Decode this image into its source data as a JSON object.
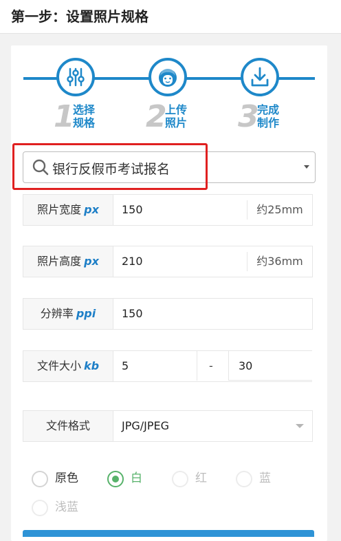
{
  "header": {
    "title": "第一步：设置照片规格"
  },
  "steps": [
    {
      "number": "1",
      "label_line1": "选择",
      "label_line2": "规格",
      "icon": "sliders-icon"
    },
    {
      "number": "2",
      "label_line1": "上传",
      "label_line2": "照片",
      "icon": "face-icon"
    },
    {
      "number": "3",
      "label_line1": "完成",
      "label_line2": "制作",
      "icon": "download-icon"
    }
  ],
  "spec_select": {
    "value": "银行反假币考试报名"
  },
  "fields": {
    "width": {
      "label": "照片宽度",
      "unit": "px",
      "value": "150",
      "suffix": "约25mm"
    },
    "height": {
      "label": "照片高度",
      "unit": "px",
      "value": "210",
      "suffix": "约36mm"
    },
    "dpi": {
      "label": "分辨率",
      "unit": "ppi",
      "value": "150"
    },
    "filesize": {
      "label": "文件大小",
      "unit": "kb",
      "min": "5",
      "separator": "-",
      "max": "30"
    },
    "format": {
      "label": "文件格式",
      "value": "JPG/JPEG"
    }
  },
  "background_colors": [
    {
      "label": "原色",
      "state": "unchecked"
    },
    {
      "label": "白",
      "state": "checked"
    },
    {
      "label": "红",
      "state": "disabled"
    },
    {
      "label": "蓝",
      "state": "disabled"
    },
    {
      "label": "浅蓝",
      "state": "disabled"
    }
  ],
  "colors": {
    "accent": "#1e88c9",
    "highlight": "#e02020",
    "checked": "#57b26a"
  }
}
